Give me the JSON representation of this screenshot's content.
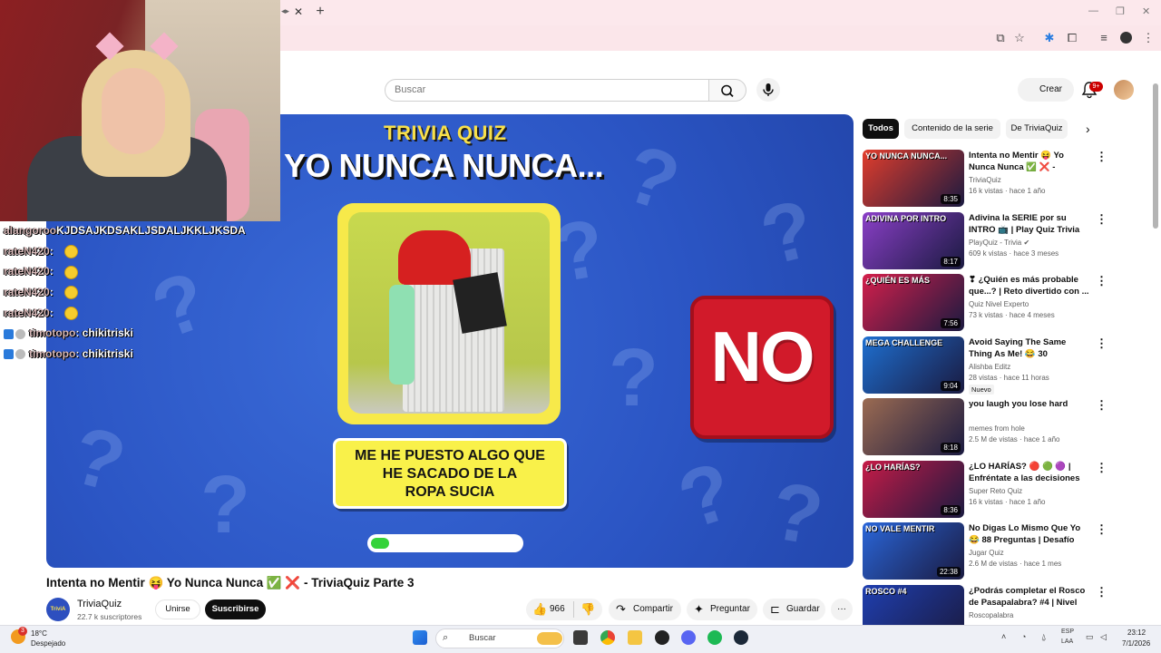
{
  "browser": {
    "tab_close": "✕",
    "tab_new": "+",
    "tab_mark": "◂▸",
    "window_controls": {
      "minimize": "—",
      "restore": "❐",
      "close": "✕"
    }
  },
  "youtube": {
    "search_placeholder": "Buscar",
    "create_label": "Crear",
    "notifications_badge": "9+"
  },
  "chat": [
    {
      "user": "alangoroo",
      "text": "KJDSAJKDSAKLJSDALJKKLJKSDA",
      "emoji": false,
      "badge": false
    },
    {
      "user": "rateN420",
      "text": ":",
      "emoji": true,
      "badge": false
    },
    {
      "user": "rateN420",
      "text": ":",
      "emoji": true,
      "badge": false
    },
    {
      "user": "rateN420",
      "text": ":",
      "emoji": true,
      "badge": false
    },
    {
      "user": "rateN420",
      "text": ":",
      "emoji": true,
      "badge": false
    },
    {
      "user": "timotopo",
      "text": ": chikitriski",
      "emoji": false,
      "badge": true
    },
    {
      "user": "timotopo",
      "text": ": chikitriski",
      "emoji": false,
      "badge": true
    }
  ],
  "video": {
    "overlay_brand": "TRIVIA QUIZ",
    "overlay_title": "YO NUNCA NUNCA...",
    "caption_lines": [
      "ME HE PUESTO ALGO QUE",
      "HE SACADO DE LA",
      "ROPA SUCIA"
    ],
    "answer": "NO",
    "progress": 0.1,
    "title": "Intenta no Mentir 😝 Yo Nunca Nunca ✅ ❌ - TriviaQuiz Parte 3",
    "channel_avatar_text": "TriviA",
    "channel_name": "TriviaQuiz",
    "subscribers": "22.7 k suscriptores",
    "join_label": "Unirse",
    "subscribe_label": "Suscribirse",
    "likes": "966",
    "share_label": "Compartir",
    "ask_label": "Preguntar",
    "save_label": "Guardar",
    "more_label": "···"
  },
  "chips": [
    {
      "label": "Todos",
      "active": true
    },
    {
      "label": "Contenido de la serie",
      "active": false
    },
    {
      "label": "De TriviaQuiz",
      "active": false
    }
  ],
  "recommendations": [
    {
      "title": "Intenta no Mentir 😝 Yo Nunca Nunca ✅ ❌ - TriviaQuiz Part...",
      "channel": "TriviaQuiz",
      "meta": "16 k vistas · hace 1 año",
      "duration": "8:35",
      "thumb_label": "YO NUNCA NUNCA...",
      "thumb_color": "#e23d2c",
      "new": ""
    },
    {
      "title": "Adivina la SERIE por su INTRO 📺 | Play Quiz Trivia",
      "channel": "PlayQuiz - Trivia ✔",
      "meta": "609 k vistas · hace 3 meses",
      "duration": "8:17",
      "thumb_label": "ADIVINA POR INTRO",
      "thumb_color": "#8a3fc7",
      "new": ""
    },
    {
      "title": "❣ ¿Quién es más probable que...? | Reto divertido con ...",
      "channel": "Quiz Nivel Experto",
      "meta": "73 k vistas · hace 4 meses",
      "duration": "7:56",
      "thumb_label": "¿QUIÉN ES MÁS",
      "thumb_color": "#d41f4b",
      "new": ""
    },
    {
      "title": "Avoid Saying The Same Thing As Me! 😂 30 Questions | ...",
      "channel": "Alishba Editz",
      "meta": "28 vistas · hace 11 horas",
      "duration": "9:04",
      "thumb_label": "MEGA CHALLENGE",
      "thumb_color": "#1e6fd0",
      "new": "Nuevo"
    },
    {
      "title": "you laugh you lose hard",
      "channel": "memes from hole",
      "meta": "2.5 M de vistas · hace 1 año",
      "duration": "8:18",
      "thumb_label": "",
      "thumb_color": "#9b6b52",
      "new": ""
    },
    {
      "title": "¿LO HARÍAS? 🔴 🟢 🟣 | Enfréntate a las decisiones m...",
      "channel": "Super Reto Quiz",
      "meta": "16 k vistas · hace 1 año",
      "duration": "8:36",
      "thumb_label": "¿LO HARÍAS?",
      "thumb_color": "#c61b47",
      "new": ""
    },
    {
      "title": "No Digas Lo Mismo Que Yo 😂 88 Preguntas | Desafío Mega ...",
      "channel": "Jugar Quiz",
      "meta": "2.6 M de vistas · hace 1 mes",
      "duration": "22:38",
      "thumb_label": "NO VALE MENTIR",
      "thumb_color": "#2a66d9",
      "new": ""
    },
    {
      "title": "¿Podrás completar el Rosco de Pasapalabra? #4 | Nivel Fácil",
      "channel": "Roscopalabra",
      "meta": "",
      "duration": "",
      "thumb_label": "ROSCO #4",
      "thumb_color": "#1f3fb0",
      "new": ""
    }
  ],
  "taskbar": {
    "weather_temp": "18°C",
    "weather_desc": "Despejado",
    "weather_badge": "3",
    "search_placeholder": "Buscar",
    "lang_top": "ESP",
    "lang_bottom": "LAA",
    "time": "23:12",
    "date": "7/1/2026"
  },
  "colors": {
    "accent_red": "#cc0000",
    "player_blue": "#2b55c4",
    "caption_yellow": "#f9f14a",
    "no_red": "#d11a2a",
    "progress_green": "#35d33a"
  },
  "icons": [
    "search-icon",
    "mic-icon",
    "bell-icon",
    "like-icon",
    "dislike-icon",
    "share-icon",
    "sparkle-icon",
    "bookmark-icon",
    "more-icon",
    "windows-icon",
    "chevron-right-icon"
  ]
}
